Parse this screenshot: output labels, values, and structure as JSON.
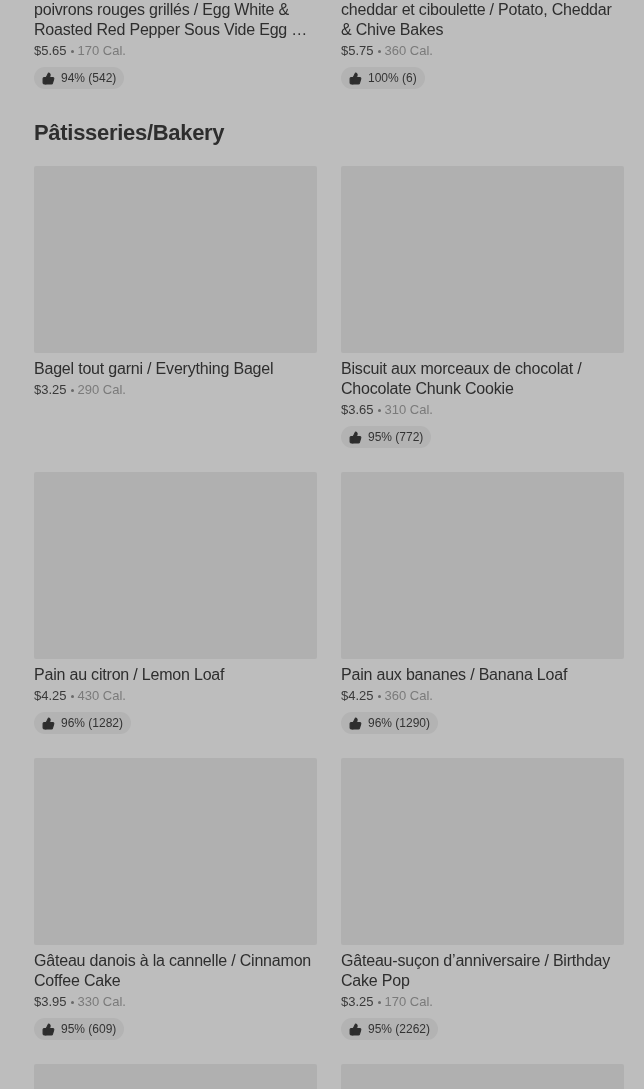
{
  "top_items": [
    {
      "title": "poivrons rouges grillés / Egg White & Roasted Red Pepper Sous Vide Egg …",
      "price": "$5.65",
      "calories": "170 Cal.",
      "rating": "94% (542)"
    },
    {
      "title": "cheddar et ciboulette / Potato, Cheddar & Chive Bakes",
      "price": "$5.75",
      "calories": "360 Cal.",
      "rating": "100% (6)"
    }
  ],
  "section": {
    "title": "Pâtisseries/Bakery",
    "items": [
      {
        "kind": "product",
        "title": "Bagel tout garni / Everything Bagel",
        "price": "$3.25",
        "calories": "290 Cal."
      },
      {
        "kind": "product",
        "title": "Biscuit aux morceaux de chocolat / Chocolate Chunk Cookie",
        "price": "$3.65",
        "calories": "310 Cal.",
        "rating": "95% (772)"
      },
      {
        "kind": "product",
        "title": "Pain au citron / Lemon Loaf",
        "price": "$4.25",
        "calories": "430 Cal.",
        "rating": "96% (1282)"
      },
      {
        "kind": "product",
        "title": "Pain aux bananes / Banana Loaf",
        "price": "$4.25",
        "calories": "360 Cal.",
        "rating": "96% (1290)"
      },
      {
        "kind": "product",
        "title": "Gâteau danois à la cannelle / Cinnamon Coffee Cake",
        "price": "$3.95",
        "calories": "330 Cal.",
        "rating": "95% (609)"
      },
      {
        "kind": "product",
        "title": "Gâteau-suçon d’anniversaire / Birthday Cake Pop",
        "price": "$3.25",
        "calories": "170 Cal.",
        "rating": "95% (2262)"
      },
      {
        "kind": "picture"
      },
      {
        "kind": "picture"
      }
    ]
  }
}
